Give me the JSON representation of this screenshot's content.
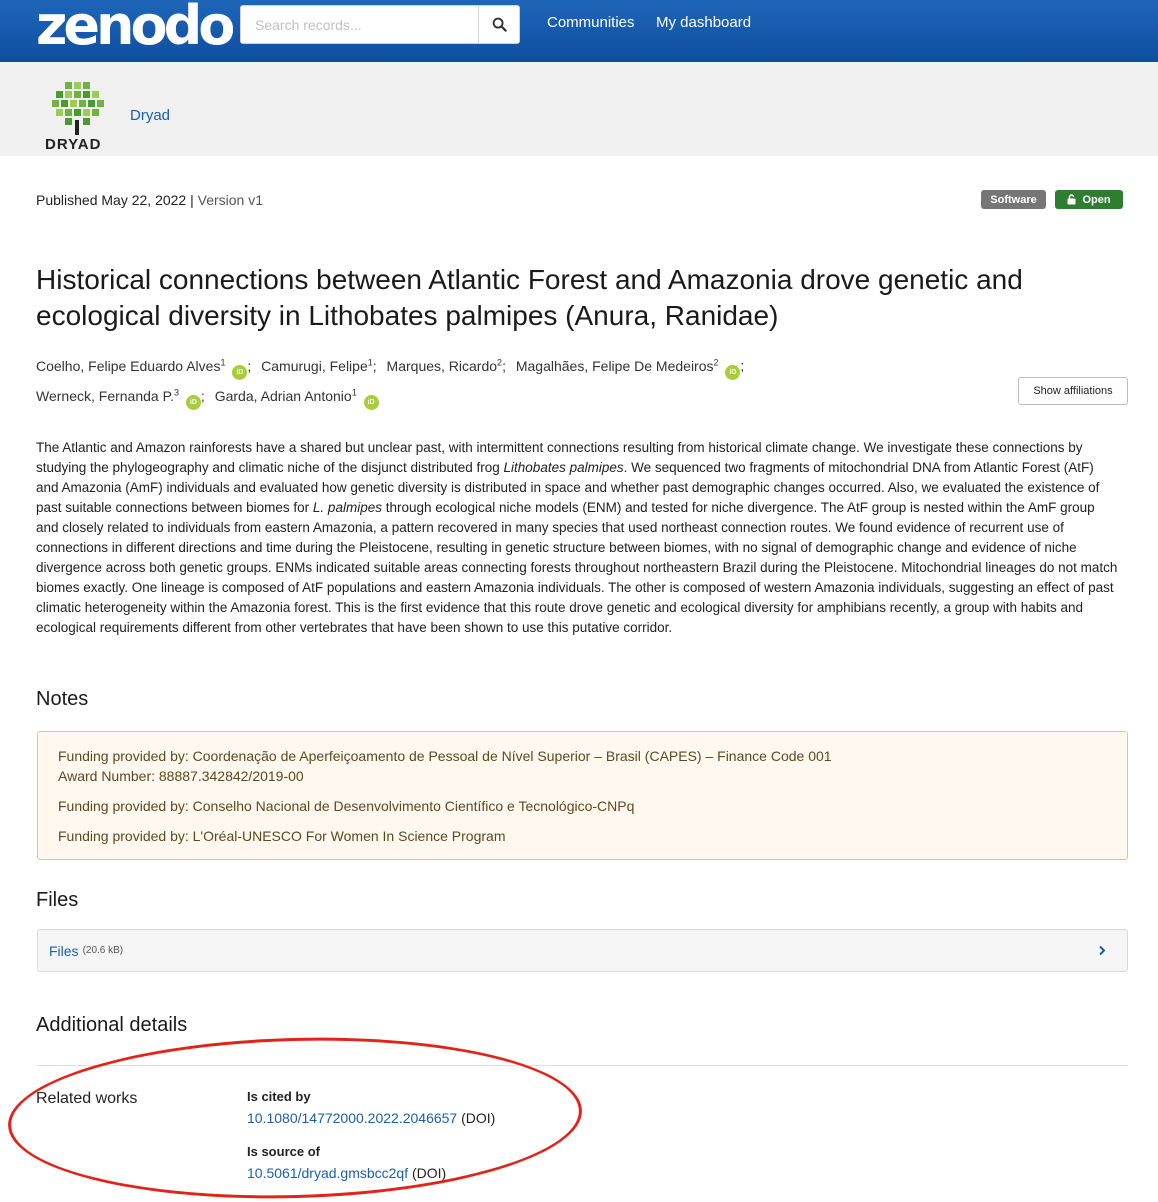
{
  "header": {
    "logo": "zenodo",
    "search_placeholder": "Search records...",
    "nav": [
      "Communities",
      "My dashboard"
    ]
  },
  "community": {
    "logo_word": "DRYAD",
    "name": "Dryad"
  },
  "record": {
    "published": "Published May 22, 2022",
    "version": "Version v1",
    "badges": {
      "type": "Software",
      "access": "Open"
    },
    "title": "Historical connections between Atlantic Forest and Amazonia drove genetic and ecological diversity in Lithobates palmipes (Anura, Ranidae)",
    "authors": [
      {
        "name": "Coelho, Felipe Eduardo Alves",
        "aff": "1",
        "orcid": true
      },
      {
        "name": "Camurugi, Felipe",
        "aff": "1",
        "orcid": false
      },
      {
        "name": "Marques, Ricardo",
        "aff": "2",
        "orcid": false
      },
      {
        "name": "Magalhães, Felipe De Medeiros",
        "aff": "2",
        "orcid": true
      },
      {
        "name": "Werneck, Fernanda P.",
        "aff": "3",
        "orcid": true
      },
      {
        "name": "Garda, Adrian Antonio",
        "aff": "1",
        "orcid": true
      }
    ],
    "orcid_label": "iD",
    "show_affiliations": "Show affiliations",
    "abstract": {
      "p1": "The Atlantic and Amazon rainforests have a shared but unclear past, with intermittent connections resulting from historical climate change. We investigate these connections by studying the phylogeography and climatic niche of the disjunct distributed frog ",
      "i1": "Lithobates palmipes",
      "p2": ". We sequenced two fragments of mitochondrial DNA from Atlantic Forest (AtF) and Amazonia (AmF) individuals and evaluated how genetic diversity is distributed in space and whether past demographic changes occurred. Also, we evaluated the existence of past suitable connections between biomes for ",
      "i2": "L. palmipes",
      "p3": " through ecological niche models (ENM) and tested for niche divergence. The AtF group is nested within the AmF group and closely related to individuals from eastern Amazonia, a pattern recovered in many species that used northeast connection routes. We found evidence of recurrent use of connections in different directions and time during the Pleistocene, resulting in genetic structure between biomes, with no signal of demographic change and evidence of niche divergence across both genetic groups. ENMs indicated suitable areas connecting forests throughout northeastern Brazil during the Pleistocene. Mitochondrial lineages do not match biomes exactly. One lineage is composed of AtF populations and eastern Amazonia individuals. The other is composed of western Amazonia individuals, suggesting an effect of past climatic heterogeneity within the Amazonia forest. This is the first evidence that this route drove genetic and ecological diversity for amphibians recently, a group with habits and ecological requirements different from other vertebrates that have been shown to use this putative corridor."
    }
  },
  "notes": {
    "heading": "Notes",
    "funding1": "Funding provided by: Coordenação de Aperfeiçoamento de Pessoal de Nível Superior – Brasil (CAPES) – Finance Code 001",
    "award1": "Award Number: 88887.342842/2019-00",
    "funding2": "Funding provided by: Conselho Nacional de Desenvolvimento Científico e Tecnológico-CNPq",
    "funding3": "Funding provided by: L'Oréal-UNESCO For Women In Science Program"
  },
  "files": {
    "heading": "Files",
    "label": "Files",
    "size": "(20.6 kB)"
  },
  "details": {
    "heading": "Additional details",
    "related_label": "Related works",
    "groups": [
      {
        "relation": "Is cited by",
        "id": "10.1080/14772000.2022.2046657",
        "scheme": "(DOI)"
      },
      {
        "relation": "Is source of",
        "id": "10.5061/dryad.gmsbcc2qf",
        "scheme": "(DOI)"
      }
    ]
  },
  "colors": {
    "header": "#1565c0",
    "link": "#1b5fa5",
    "open_badge": "#2f7d31",
    "annotation": "#e2231a"
  }
}
